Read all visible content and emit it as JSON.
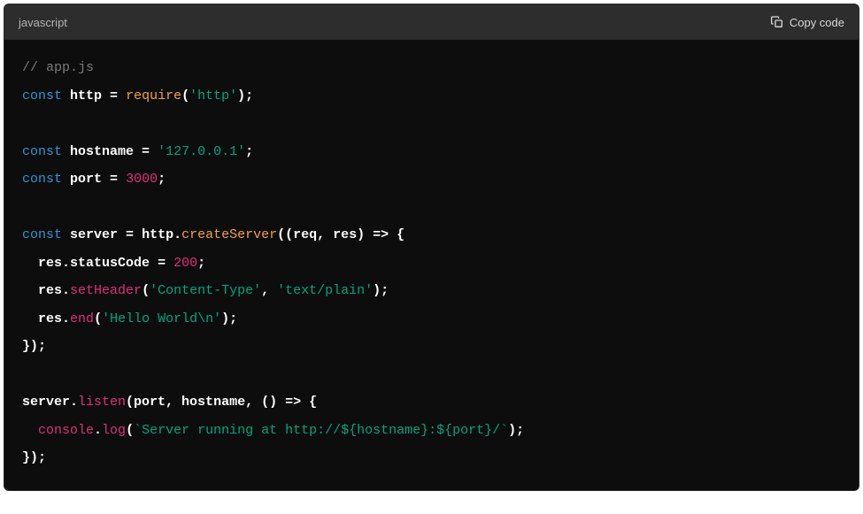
{
  "header": {
    "language": "javascript",
    "copy_label": "Copy code"
  },
  "code": {
    "comment": "// app.js",
    "const1": "const",
    "http": "http",
    "eq": " = ",
    "require": "require",
    "lparen": "(",
    "rparen": ")",
    "semi": ";",
    "str_http": "'http'",
    "const2": "const",
    "hostname": "hostname",
    "str_hostname": "'127.0.0.1'",
    "const3": "const",
    "port": "port",
    "num_port": "3000",
    "const4": "const",
    "server": "server",
    "httpvar": "http",
    "dot": ".",
    "createServer": "createServer",
    "params1": "((req, res) ",
    "arrow": "=>",
    "lbrace": " {",
    "indent": "  ",
    "res": "res",
    "statusCode": "statusCode",
    "num_200": "200",
    "setHeader": "setHeader",
    "str_ct": "'Content-Type'",
    "comma": ", ",
    "str_tp": "'text/plain'",
    "end": "end",
    "str_hello": "'Hello World\\n'",
    "rbrace_paren_semi": "});",
    "servervar": "server",
    "listen": "listen",
    "params2": "(port, hostname, () ",
    "console": "console",
    "log": "log",
    "template": "`Server running at http://${hostname}:${port}/`",
    "rparen_semi": ");"
  }
}
